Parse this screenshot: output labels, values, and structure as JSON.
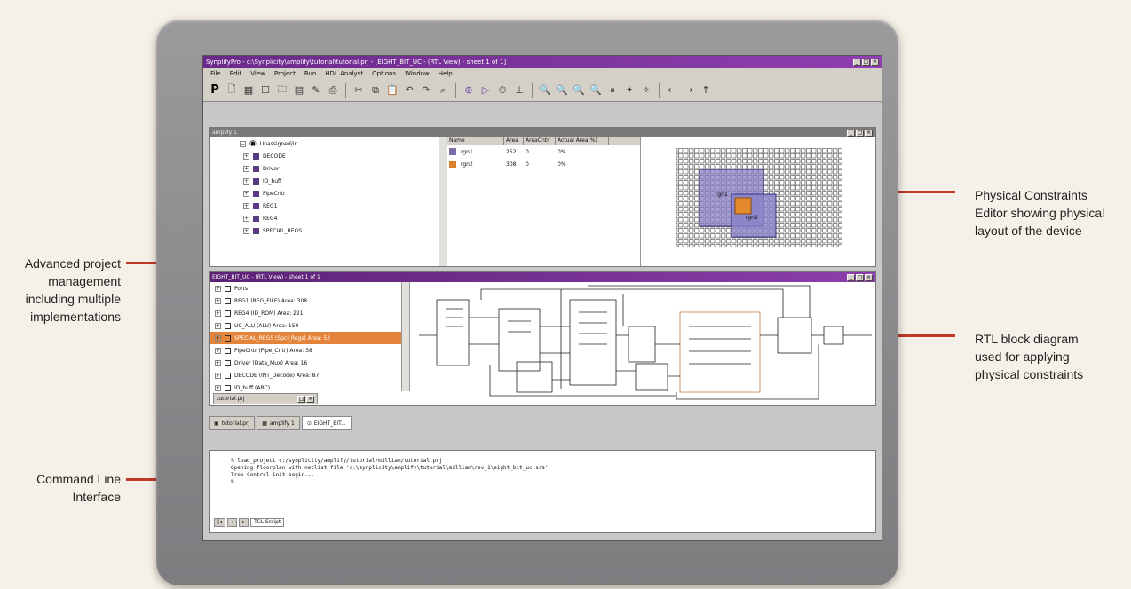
{
  "callouts": {
    "physical_editor": [
      "Physical Constraints",
      "Editor showing physical",
      "layout of the device"
    ],
    "project_mgmt": [
      "Advanced project",
      "management",
      "including multiple",
      "implementations"
    ],
    "rtl_diagram": [
      "RTL block diagram",
      "used for applying",
      "physical constraints"
    ],
    "cli": [
      "Command Line",
      "Interface"
    ]
  },
  "window": {
    "title": "SynplifyPro - c:\\Synplicity\\amplify\\tutorial\\tutorial.prj - [EIGHT_BIT_UC - (RTL View) - sheet 1 of 1]",
    "menu": [
      "File",
      "Edit",
      "View",
      "Project",
      "Run",
      "HDL Analyst",
      "Options",
      "Window",
      "Help"
    ]
  },
  "physical_panel": {
    "title": "amplify 1",
    "tree_root": "Unassigned/in",
    "tree_items": [
      "DECODE",
      "Driver",
      "ID_buff",
      "PipeCntr",
      "REG1",
      "REG4",
      "SPECIAL_REGS"
    ],
    "table_headers": [
      "Name",
      "Area",
      "AreaCntr",
      "Actual Area(%)"
    ],
    "table_rows": [
      {
        "name": "rgn1",
        "area": "252",
        "areacntr": "0",
        "actual": "0%"
      },
      {
        "name": "rgn2",
        "area": "308",
        "areacntr": "0",
        "actual": "0%"
      }
    ],
    "region_labels": [
      "rgn1",
      "rgn2"
    ]
  },
  "rtl_panel": {
    "title": "EIGHT_BIT_UC - (RTL View) - sheet 1 of 1",
    "tree_items": [
      "Ports",
      "REG1 (REG_FILE) Area: 308",
      "REG4 (ID_ROM) Area: 221",
      "UC_ALU (ALU) Area: 150",
      "SPECIAL_REGS (Spcl_Regs) Area: 52",
      "PipeCntr (Pipe_Cntr) Area: 38",
      "Driver (Data_Mux) Area: 16",
      "DECODE (INT_Decode) Area: 87",
      "ID_buff (ABC)"
    ],
    "selected_index": 4,
    "minimized_title": "tutorial.prj"
  },
  "tabs": [
    "tutorial.prj",
    "amplify 1",
    "EIGHT_BIT..."
  ],
  "command_line": [
    "% load_project c:/synplicity/amplify/tutorial/milliam/tutorial.prj",
    "Opening floorplan with netlist file 'c:\\synplicity\\amplify\\tutorial\\milliam\\rev_1\\eight_bit_uc.srs'",
    "Tree Control init begin...",
    "%"
  ],
  "command_tab": "TCL Script"
}
